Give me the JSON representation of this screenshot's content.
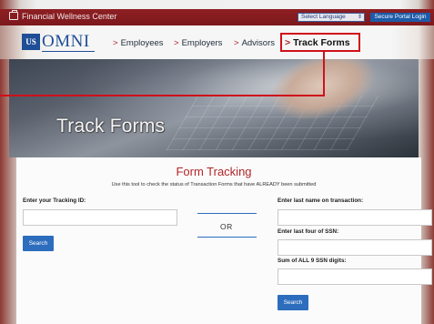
{
  "topbar": {
    "site_name": "Financial Wellness Center",
    "language_select": "Select Language",
    "portal_button": "Secure Portal Login"
  },
  "nav": {
    "logo_mark": "US",
    "logo_text": "OMNI",
    "items": [
      {
        "label": "Employees"
      },
      {
        "label": "Employers"
      },
      {
        "label": "Advisors"
      },
      {
        "label": "Track Forms"
      }
    ],
    "active_item": "Track Forms"
  },
  "hero": {
    "title": "Track Forms"
  },
  "form": {
    "title": "Form Tracking",
    "subtitle": "Use this tool to check the status of Transaction Forms that have ALREADY been submitted",
    "tracking_id_label": "Enter your Tracking ID:",
    "tracking_id_value": "",
    "search_label_left": "Search",
    "or_label": "OR",
    "last_name_label": "Enter last name on transaction:",
    "last_name_value": "",
    "ssn_last4_label": "Enter last four of SSN:",
    "ssn_last4_value": "",
    "ssn_sum_label": "Sum of ALL 9 SSN digits:",
    "ssn_sum_value": "",
    "search_label_right": "Search"
  },
  "colors": {
    "brand_red": "#8e1f23",
    "brand_blue": "#1f4e96",
    "highlight_red": "#d0101a",
    "button_blue": "#2d6dbd"
  }
}
